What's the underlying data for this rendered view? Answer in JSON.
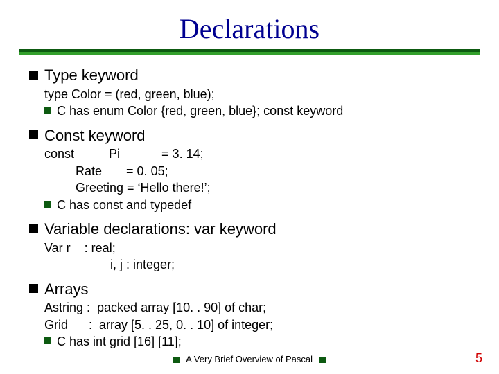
{
  "title": "Declarations",
  "bullets": {
    "b1": {
      "heading": "Type keyword",
      "line1": "type Color = (red, green, blue);",
      "sub1": "C has  enum Color {red, green, blue}; const keyword"
    },
    "b2": {
      "heading": "Const keyword",
      "line1": "const          Pi            = 3. 14;",
      "line2": "         Rate       = 0. 05;",
      "line3": "         Greeting = ‘Hello there!’;",
      "sub1": "C has const and typedef"
    },
    "b3": {
      "heading": "Variable declarations:  var keyword",
      "line1": "Var r    : real;",
      "line2": "                   i, j : integer;"
    },
    "b4": {
      "heading": "Arrays",
      "line1": "Astring :  packed array [10. . 90] of char;",
      "line2": "Grid      :  array [5. . 25, 0. . 10] of integer;",
      "sub1": "C has int grid [16] [11];"
    }
  },
  "footer": "A Very Brief Overview of Pascal",
  "page": "5"
}
